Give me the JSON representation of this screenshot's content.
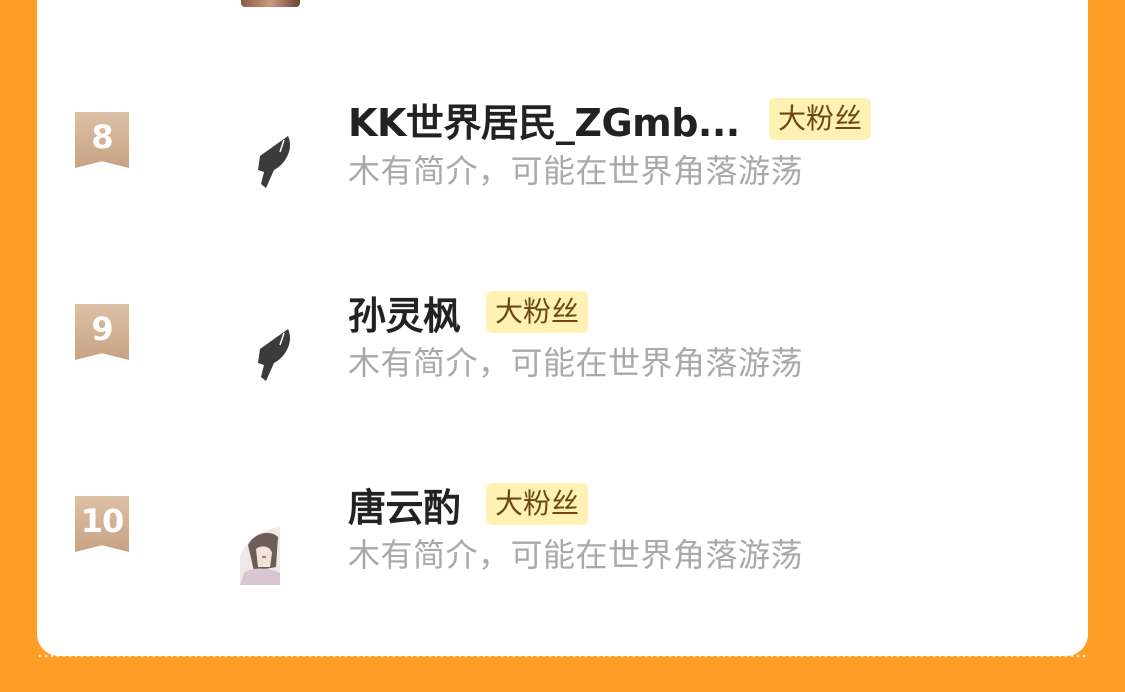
{
  "fan_list": {
    "items": [
      {
        "rank": "8",
        "name": "KK世界居民_ZGmb...",
        "tag": "大粉丝",
        "bio": "木有简介，可能在世界角落游荡",
        "avatar_icon": "fish-tail-icon"
      },
      {
        "rank": "9",
        "name": "孙灵枫",
        "tag": "大粉丝",
        "bio": "木有简介，可能在世界角落游荡",
        "avatar_icon": "fish-tail-icon"
      },
      {
        "rank": "10",
        "name": "唐云酌",
        "tag": "大粉丝",
        "bio": "木有简介，可能在世界角落游荡",
        "avatar_icon": "anime-avatar-icon"
      }
    ]
  },
  "colors": {
    "background": "#FF9D26",
    "card": "#FFFFFF",
    "rank_badge": "#D4B393",
    "tag_bg": "#FFF1B3",
    "name": "#222222",
    "bio": "#A9A9A9"
  }
}
